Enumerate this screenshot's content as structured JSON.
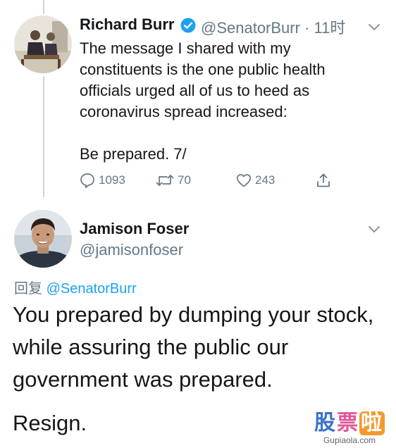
{
  "tweet1": {
    "name": "Richard Burr",
    "verified_icon": "verified-badge-icon",
    "handle_time": "@SenatorBurr · 11时",
    "text_lines": [
      "The message I shared with my",
      "constituents is the one public health",
      "officials urged all of us to heed as",
      "coronavirus spread increased:",
      "",
      "Be prepared. 7/"
    ],
    "actions": {
      "replies": "1093",
      "retweets": "70",
      "likes": "243"
    }
  },
  "tweet2": {
    "name": "Jamison Foser",
    "handle": "@jamisonfoser",
    "reply_label": "回复",
    "reply_mention": "@SenatorBurr",
    "text_lines": [
      "You prepared by dumping your stock,",
      "while assuring the public our",
      "government was prepared."
    ],
    "text_last": "Resign."
  },
  "watermark": {
    "chars": [
      "股",
      "票",
      "啦"
    ],
    "url": "Gupiaola.com"
  },
  "colors": {
    "verified": "#1da1f2",
    "secondary": "#657786",
    "link": "#1da1f2",
    "watermark_blue": "#3a73c9",
    "watermark_pink": "#e0579a",
    "watermark_orange": "#f39a2e"
  }
}
